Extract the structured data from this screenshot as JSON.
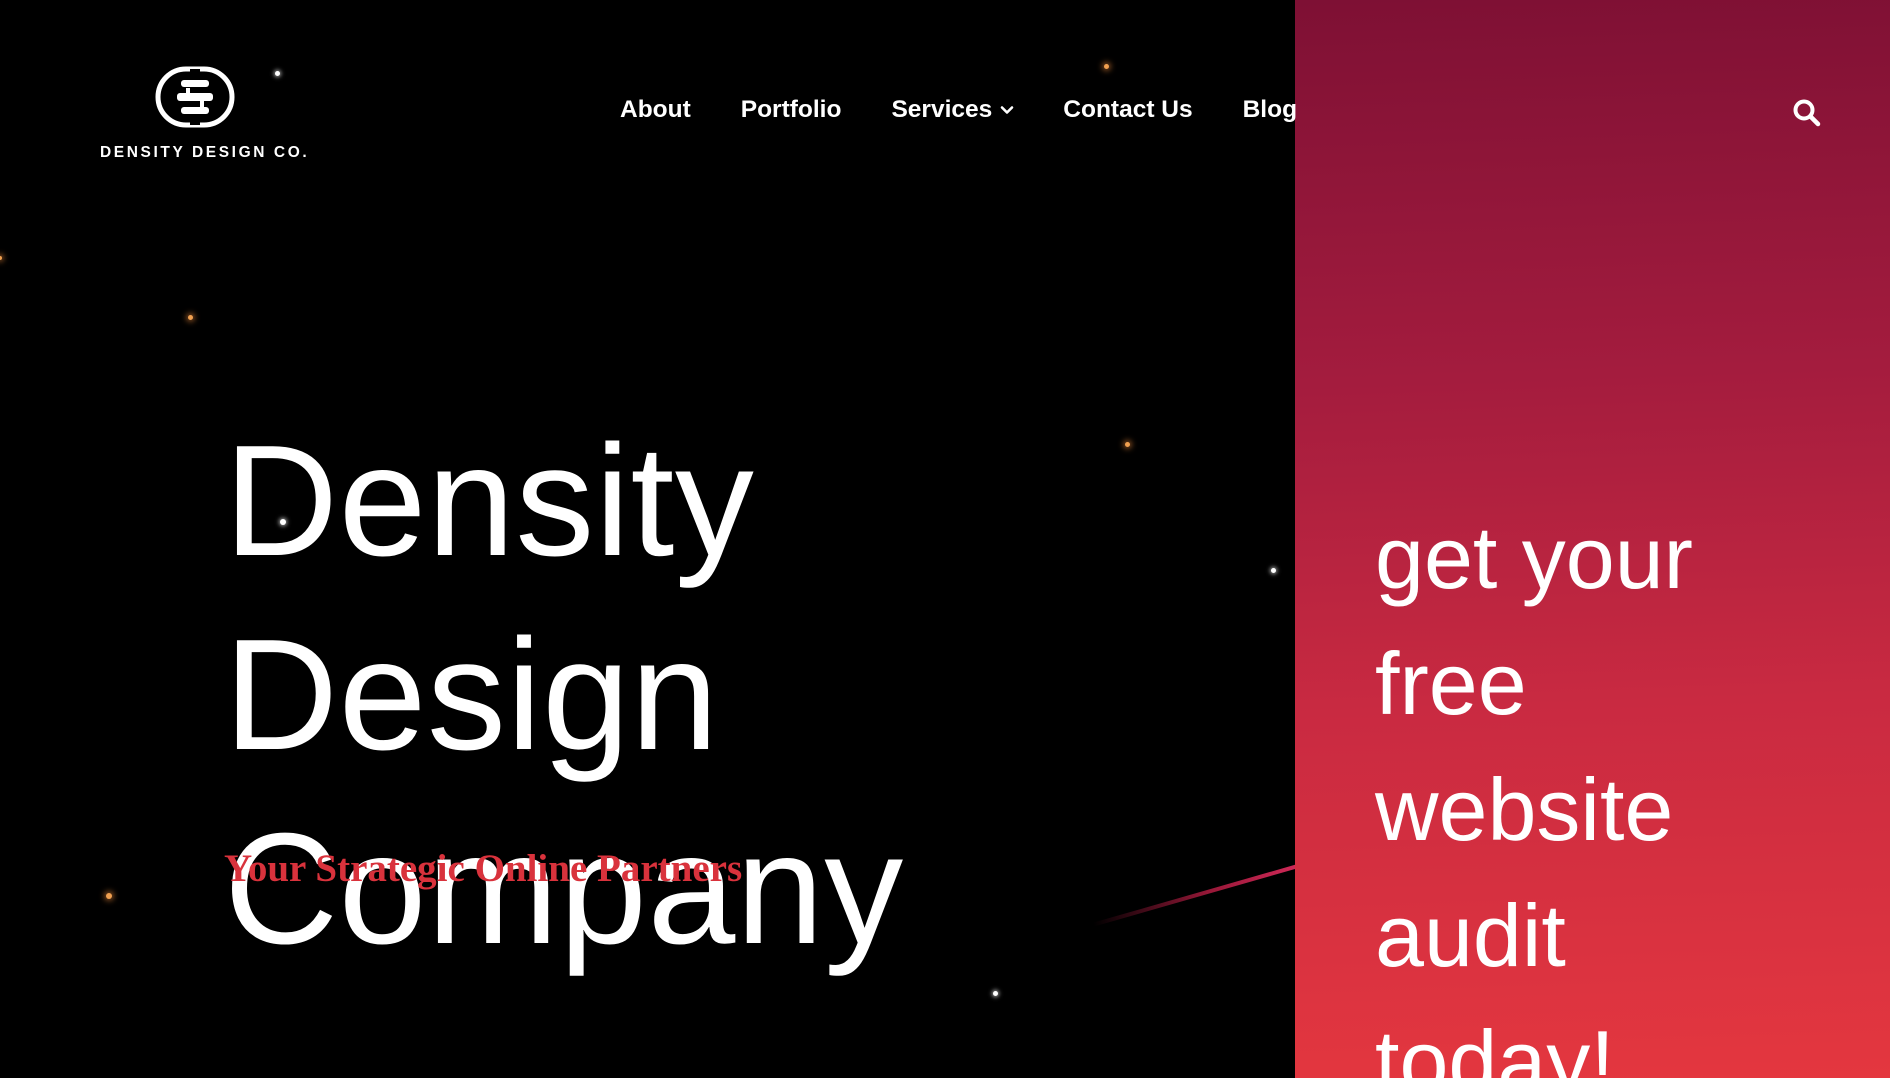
{
  "brand": {
    "logo_text": "DENSITY DESIGN CO.",
    "icon": "density-logo-icon"
  },
  "nav": {
    "items": [
      {
        "label": "About"
      },
      {
        "label": "Portfolio"
      },
      {
        "label": "Services",
        "has_dropdown": true,
        "icon": "chevron-down-icon"
      },
      {
        "label": "Contact Us"
      },
      {
        "label": "Blog"
      }
    ],
    "search_icon": "search-icon"
  },
  "hero": {
    "title_line1": "Density Design",
    "title_line2": "Company",
    "subtitle": "Your Strategic Online Partners"
  },
  "cta": {
    "line1": "get your",
    "line2": "free",
    "line3": "website",
    "line4": "audit",
    "line5": "today!"
  },
  "colors": {
    "background": "#000000",
    "accent": "#d9323c",
    "panel_top": "#7e1034",
    "panel_bottom": "#e4373f",
    "text": "#ffffff"
  }
}
